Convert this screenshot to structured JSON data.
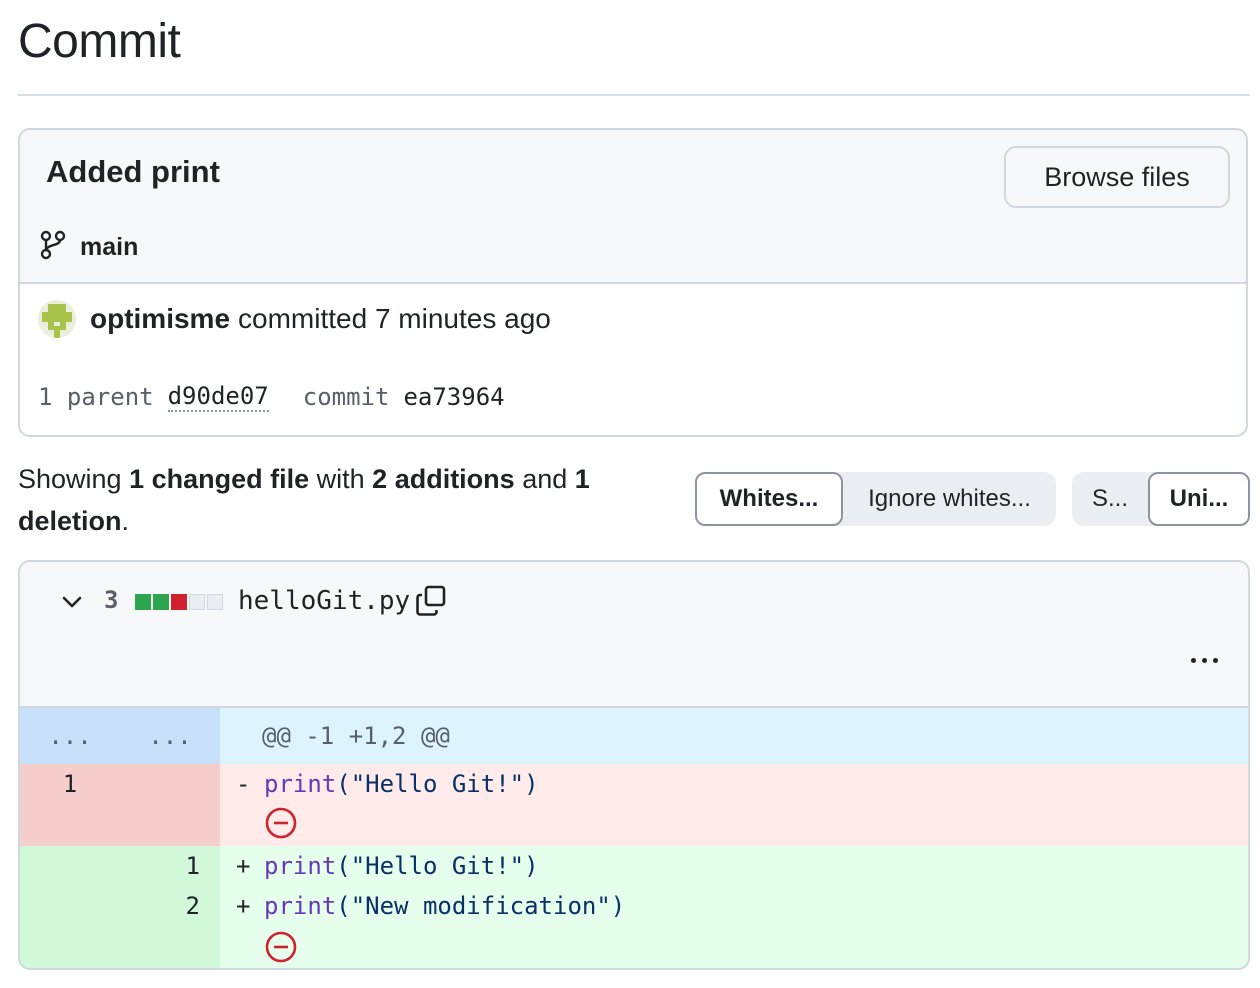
{
  "page": {
    "title": "Commit"
  },
  "commit": {
    "message": "Added print",
    "browse_label": "Browse files",
    "branch": "main",
    "author": "optimisme",
    "action": "committed 7 minutes ago",
    "parent_label": "1 parent",
    "parent_sha": "d90de07",
    "commit_label": "commit",
    "commit_sha": "ea73964"
  },
  "summary": {
    "showing": "Showing ",
    "changed": "1 changed file",
    "with": " with ",
    "additions": "2 additions",
    "and": " and ",
    "deletions": "1 deletion",
    "end": "."
  },
  "whitespace_toggle": {
    "options": [
      "Whites...",
      "Ignore whites..."
    ],
    "selected": 0
  },
  "view_toggle": {
    "options": [
      "S...",
      "Uni..."
    ],
    "selected": 1
  },
  "file": {
    "change_count": "3",
    "diffstat": [
      "added",
      "added",
      "deleted",
      "neutral",
      "neutral"
    ],
    "name": "helloGit.py",
    "hunk_ellipsis_old": "...",
    "hunk_ellipsis_new": "...",
    "hunk_header": "@@ -1 +1,2 @@",
    "lines": [
      {
        "type": "del",
        "old": "1",
        "new": "",
        "marker": "-",
        "fn": "print",
        "arg": "(\"Hello Git!\")"
      },
      {
        "type": "add",
        "old": "",
        "new": "1",
        "marker": "+",
        "fn": "print",
        "arg": "(\"Hello Git!\")"
      },
      {
        "type": "add",
        "old": "",
        "new": "2",
        "marker": "+",
        "fn": "print",
        "arg": "(\"New modification\")"
      }
    ]
  },
  "colors": {
    "added": "#2da44e",
    "deleted": "#cf222e",
    "neutral": "#eaeef2",
    "no_newline": "#cf222e"
  }
}
